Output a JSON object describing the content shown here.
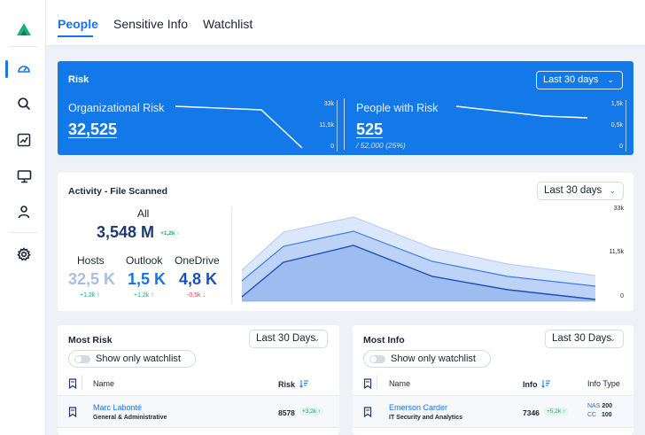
{
  "tabs": [
    {
      "label": "People"
    },
    {
      "label": "Sensitive Info"
    },
    {
      "label": "Watchlist"
    }
  ],
  "sidebar": {
    "icons": [
      "dashboard-icon",
      "search-icon",
      "chart-icon",
      "monitor-icon",
      "user-icon",
      "gear-icon"
    ]
  },
  "colors": {
    "accent": "#1a73e8",
    "risk_card": "#1479e8",
    "up": "#1fa971",
    "down": "#e04a4a"
  },
  "risk": {
    "title": "Risk",
    "period": "Last 30 days",
    "org": {
      "label": "Organizational Risk",
      "value": "32,525",
      "ticks": [
        "33k",
        "11,5k",
        "0"
      ]
    },
    "people": {
      "label": "People with Risk",
      "value": "525",
      "sub": "/ 52,000 (25%)",
      "ticks": [
        "1,5k",
        "0,5k",
        "0"
      ]
    }
  },
  "activity": {
    "title": "Activity - File Scanned",
    "period": "Last 30 days",
    "all": {
      "label": "All",
      "value": "3,548 M",
      "delta": "+1,2k ↑"
    },
    "columns": [
      {
        "label": "Hosts",
        "value": "32,5 K",
        "delta": "+1,2k ↑"
      },
      {
        "label": "Outlook",
        "value": "1,5 K",
        "delta": "+1,2k ↑"
      },
      {
        "label": "OneDrive",
        "value": "4,8 K",
        "delta": "-0,5k ↓"
      }
    ],
    "ticks": [
      "33k",
      "11,5k",
      "0"
    ]
  },
  "most_risk": {
    "title": "Most Risk",
    "period": "Last 30 Days",
    "toggle_label": "Show only watchlist",
    "headers": {
      "name": "Name",
      "metric": "Risk"
    },
    "rows": [
      {
        "name": "Marc Labonté",
        "dept": "General & Administrative",
        "value": "8578",
        "delta": "+3,2k ↑"
      }
    ]
  },
  "most_info": {
    "title": "Most Info",
    "period": "Last 30 Days",
    "toggle_label": "Show only watchlist",
    "headers": {
      "name": "Name",
      "metric": "Info",
      "type": "Info Type"
    },
    "rows": [
      {
        "name": "Emerson Carder",
        "dept": "IT Security and Analytics",
        "value": "7346",
        "delta": "+5,2k ↑",
        "types": [
          {
            "code": "NAS",
            "count": "200"
          },
          {
            "code": "CC",
            "count": "100"
          }
        ]
      }
    ]
  }
}
